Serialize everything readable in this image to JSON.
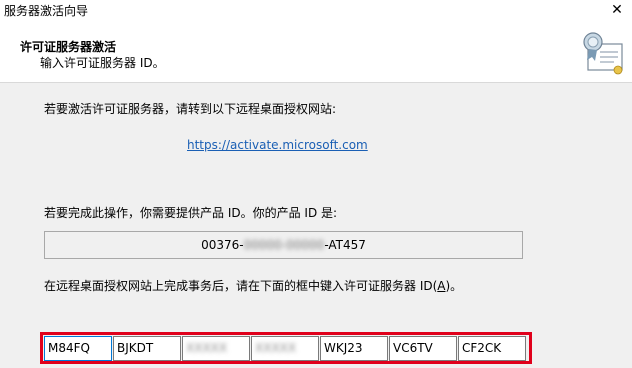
{
  "window": {
    "title": "服务器激活向导",
    "close_glyph": "✕"
  },
  "header": {
    "title": "许可证服务器激活",
    "subtitle": "输入许可证服务器 ID。",
    "icon": "certificate-icon"
  },
  "main": {
    "instruction1": "若要激活许可证服务器，请转到以下远程桌面授权网站:",
    "activation_url": "https://activate.microsoft.com",
    "instruction2": "若要完成此操作，你需要提供产品 ID。你的产品 ID 是:",
    "product_id": {
      "prefix": "00376-",
      "masked_middle": "00000-00000",
      "suffix": "-AT457"
    },
    "instruction3_prefix": "在远程桌面授权网站上完成事务后，请在下面的框中键入许可证服务器 ID(",
    "instruction3_accel": "A",
    "instruction3_suffix": ")。",
    "server_id_fields": [
      "M84FQ",
      "BJKDT",
      "XXXXX",
      "XXXXX",
      "WKJ23",
      "VC6TV",
      "CF2CK"
    ]
  },
  "colors": {
    "highlight": "#e0001b",
    "link": "#1a5fb4",
    "focus": "#0078d7"
  }
}
